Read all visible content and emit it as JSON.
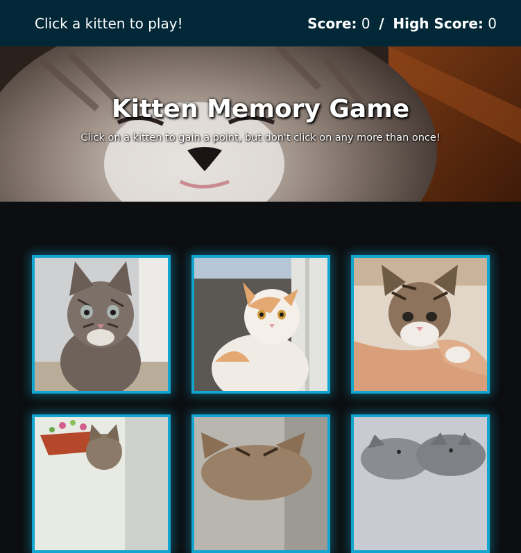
{
  "topbar": {
    "message": "Click a kitten to play!",
    "score_label": "Score:",
    "score_value": "0",
    "separator": "/",
    "high_score_label": "High Score:",
    "high_score_value": "0"
  },
  "hero": {
    "title": "Kitten Memory Game",
    "subtitle": "Click on a kitten to gain a point, but don't click on any more than once!"
  },
  "colors": {
    "topbar": "#022838",
    "card_border": "#12a5cf",
    "background": "#0c0e10"
  },
  "cards": [
    {
      "name": "tabby-kitten-card"
    },
    {
      "name": "orange-white-kitten-card"
    },
    {
      "name": "kitten-in-hand-card"
    },
    {
      "name": "kitten-in-flowerpot-card"
    },
    {
      "name": "tabby-kitten-ears-card"
    },
    {
      "name": "grey-kittens-card"
    }
  ]
}
